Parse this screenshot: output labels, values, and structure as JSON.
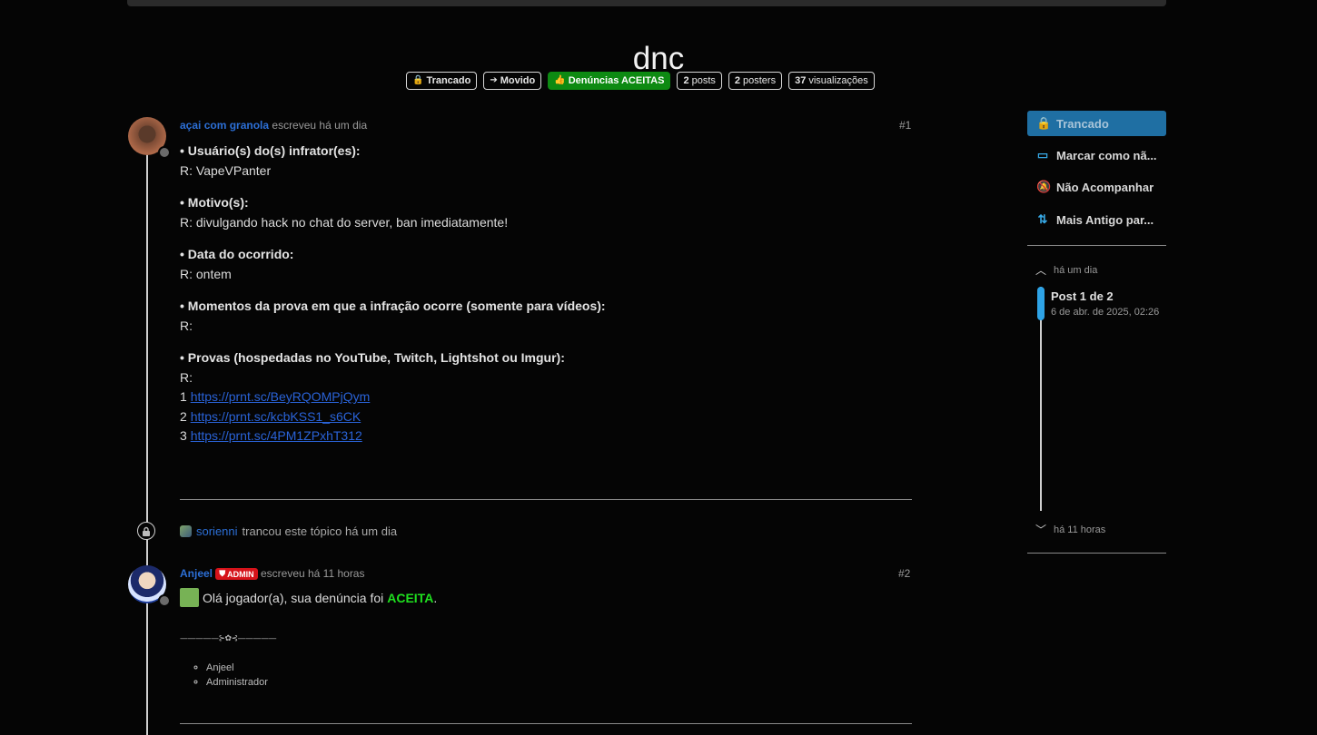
{
  "topic": {
    "title": "dnc",
    "badges": {
      "locked": "Trancado",
      "moved": "Movido",
      "category": "Denúncias ACEITAS",
      "posts_count": "2",
      "posts_label": "posts",
      "posters_count": "2",
      "posters_label": "posters",
      "views_count": "37",
      "views_label": "visualizações"
    }
  },
  "post1": {
    "username": "açai com granola",
    "meta": "escreveu há um dia",
    "number": "#1",
    "sections": [
      {
        "heading": "• Usuário(s) do(s) infrator(es):",
        "answer": "R: VapeVPanter"
      },
      {
        "heading": "• Motivo(s):",
        "answer": "R: divulgando hack no chat do server, ban imediatamente!"
      },
      {
        "heading": "• Data do ocorrido:",
        "answer": "R: ontem"
      },
      {
        "heading": "• Momentos da prova em que a infração ocorre (somente para vídeos):",
        "answer": "R:"
      },
      {
        "heading": "• Provas (hospedadas no YouTube, Twitch, Lightshot ou Imgur):",
        "answer": "R:"
      }
    ],
    "links": [
      {
        "prefix": "1",
        "url": "https://prnt.sc/BeyRQOMPjQym"
      },
      {
        "prefix": "2",
        "url": "https://prnt.sc/kcbKSS1_s6CK"
      },
      {
        "prefix": "3",
        "url": "https://prnt.sc/4PM1ZPxhT312"
      }
    ]
  },
  "small_action": {
    "username": "sorienni",
    "text": "trancou este tópico há um dia"
  },
  "post2": {
    "username": "Anjeel",
    "badge": "ADMIN",
    "meta": "escreveu há 11 horas",
    "number": "#2",
    "message_prefix": "Olá jogador(a), sua denúncia foi",
    "message_highlight": "ACEITA",
    "message_suffix": ".",
    "ornament": "—————⊱✿⊰—————",
    "signature": [
      "Anjeel",
      "Administrador"
    ]
  },
  "sidebar": {
    "buttons": {
      "locked": "Trancado",
      "mark": "Marcar como nã...",
      "unwatch": "Não Acompanhar",
      "order": "Mais Antigo par..."
    },
    "timeline": {
      "top_label": "há um dia",
      "current": "Post 1 de 2",
      "current_date": "6 de abr. de 2025, 02:26",
      "bottom_label": "há 11 horas"
    }
  },
  "colors": {
    "background": "#050505",
    "link": "#2c6fd6",
    "category_green": "#0d8a12",
    "primary_button": "#1f6fa3",
    "accent_blue": "#2ea3e6",
    "accepted_green": "#1fe01f",
    "admin_red": "#d6131a"
  }
}
